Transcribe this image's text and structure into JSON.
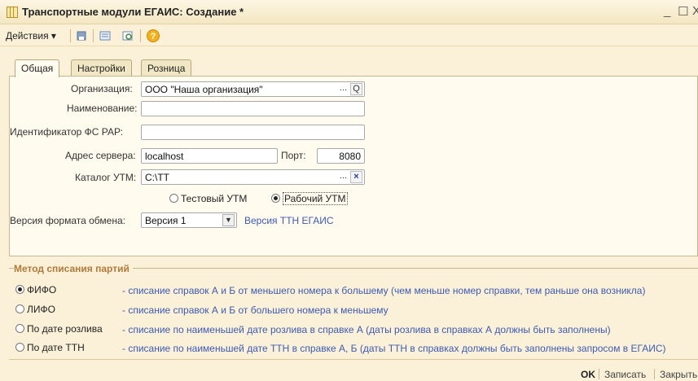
{
  "window": {
    "title": "Транспортные модули ЕГАИС: Создание *",
    "minimize": "_",
    "maximize": "☐",
    "close": "X"
  },
  "toolbar": {
    "actions_label": "Действия",
    "actions_arrow": "▾",
    "help": "?"
  },
  "tabs": [
    "Общая",
    "Настройки",
    "Розница"
  ],
  "form": {
    "organization_label": "Организация:",
    "organization_value": "ООО \"Наша организация\"",
    "name_label": "Наименование:",
    "name_value": "",
    "fsrar_label": "Идентификатор ФС РАР:",
    "fsrar_value": "",
    "server_label": "Адрес сервера:",
    "server_value": "localhost",
    "port_label": "Порт:",
    "port_value": "8080",
    "utm_dir_label": "Каталог УТМ:",
    "utm_dir_value": "C:\\TT",
    "ellipsis": "...",
    "search_glyph": "Q",
    "clear_glyph": "×",
    "test_utm": "Тестовый УТМ",
    "work_utm": "Рабочий УТМ",
    "format_label": "Версия формата обмена:",
    "format_value": "Версия 1",
    "format_link": "Версия ТТН ЕГАИС"
  },
  "method": {
    "title": "Метод списания партий",
    "options": [
      {
        "label": "ФИФО",
        "desc": "- списание справок А и Б от меньшего номера к большему (чем меньше номер справки, тем раньше она возникла)",
        "selected": true
      },
      {
        "label": "ЛИФО",
        "desc": "- списание справок А и Б от большего номера к меньшему",
        "selected": false
      },
      {
        "label": "По дате розлива",
        "desc": "- списание по наименьшей дате розлива в справке А (даты розлива в справках А должны быть заполнены)",
        "selected": false
      },
      {
        "label": "По дате ТТН",
        "desc": "- списание по наименьшей дате ТТН в справке А, Б (даты ТТН в справках должны быть заполнены запросом в ЕГАИС)",
        "selected": false
      }
    ]
  },
  "buttons": {
    "ok": "OK",
    "save": "Записать",
    "close": "Закрыть"
  },
  "colors": {
    "background": "#fbf1d8",
    "link": "#3c5ab5",
    "group_title": "#b07a3a",
    "help_icon": "#f3b21b"
  }
}
